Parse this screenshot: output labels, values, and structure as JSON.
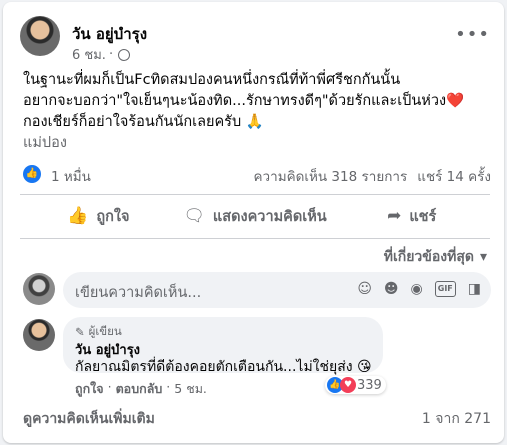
{
  "post": {
    "author": "วัน อยู่บำรุง",
    "time": "6 ชม.",
    "privacy_icon": "globe-icon",
    "text_lines": [
      "ในฐานะที่ผมก็เป็นFcทิดสมปองคนหนึ่งกรณีที่ท้าพี่ศรีชกกันนั้น",
      "อยากจะบอกว่า\"ใจเย็นๆนะน้องทิด...รักษาทรงดีๆ\"ด้วยรักและเป็นห่วง❤️",
      "กองเชียร์ก็อย่าใจร้อนกันนักเลยครับ 🙏"
    ],
    "see_more": "แม่ปอง"
  },
  "stats": {
    "likes": "1 หมื่น",
    "comments": "ความคิดเห็น 318 รายการ",
    "shares": "แชร์ 14 ครั้ง"
  },
  "actions": {
    "like": "ถูกใจ",
    "comment": "แสดงความคิดเห็น",
    "share": "แชร์"
  },
  "sort_label": "ที่เกี่ยวข้องที่สุด",
  "composer": {
    "placeholder": "เขียนความคิดเห็น..."
  },
  "comment": {
    "badge": "ผู้เขียน",
    "name": "วัน อยู่บำรุง",
    "text": "กัลยาณมิตรที่ดีต้องคอยตักเตือนกัน...ไม่ใช่ยุส่ง 😘",
    "like": "ถูกใจ",
    "reply": "ตอบกลับ",
    "time": "5 ชม.",
    "reaction_count": "339"
  },
  "footer": {
    "more_comments": "ดูความคิดเห็นเพิ่มเติม",
    "pager": "1 จาก 271"
  },
  "colors": {
    "accent": "#1877f2",
    "love": "#f33e58",
    "secondary_text": "#65676b"
  }
}
